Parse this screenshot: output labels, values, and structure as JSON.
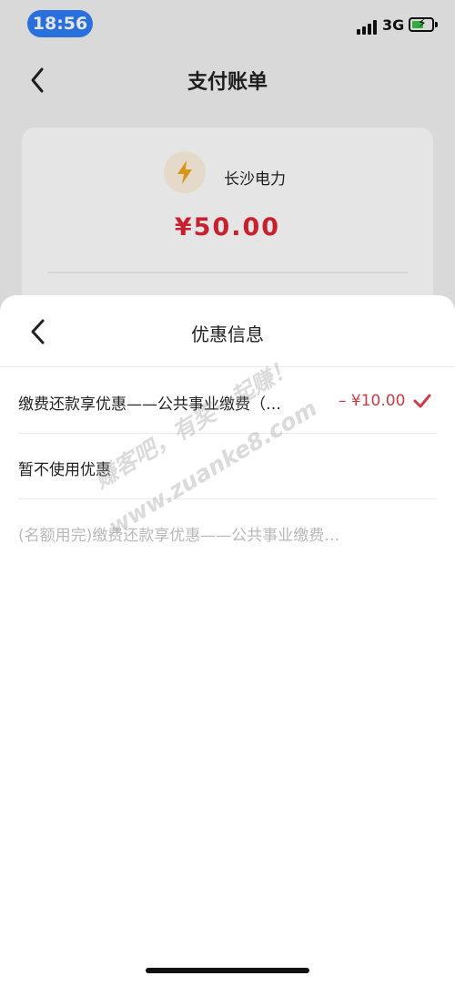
{
  "status_bar": {
    "time": "18:56",
    "network": "3G"
  },
  "background_page": {
    "title": "支付账单",
    "merchant": "长沙电力",
    "amount": "¥50.00"
  },
  "sheet": {
    "title": "优惠信息",
    "options": [
      {
        "label": "缴费还款享优惠——公共事业缴费（…",
        "price": "– ¥10.00",
        "selected": true
      },
      {
        "label": "暂不使用优惠"
      },
      {
        "label": "(名额用完)缴费还款享优惠——公共事业缴费…",
        "disabled": true
      }
    ]
  },
  "watermark": {
    "line1": "赚客吧，有奖一起赚！",
    "line2": "www.zuanke8.com"
  },
  "colors": {
    "accent_red": "#e02434",
    "status_blue": "#2f7df6"
  }
}
